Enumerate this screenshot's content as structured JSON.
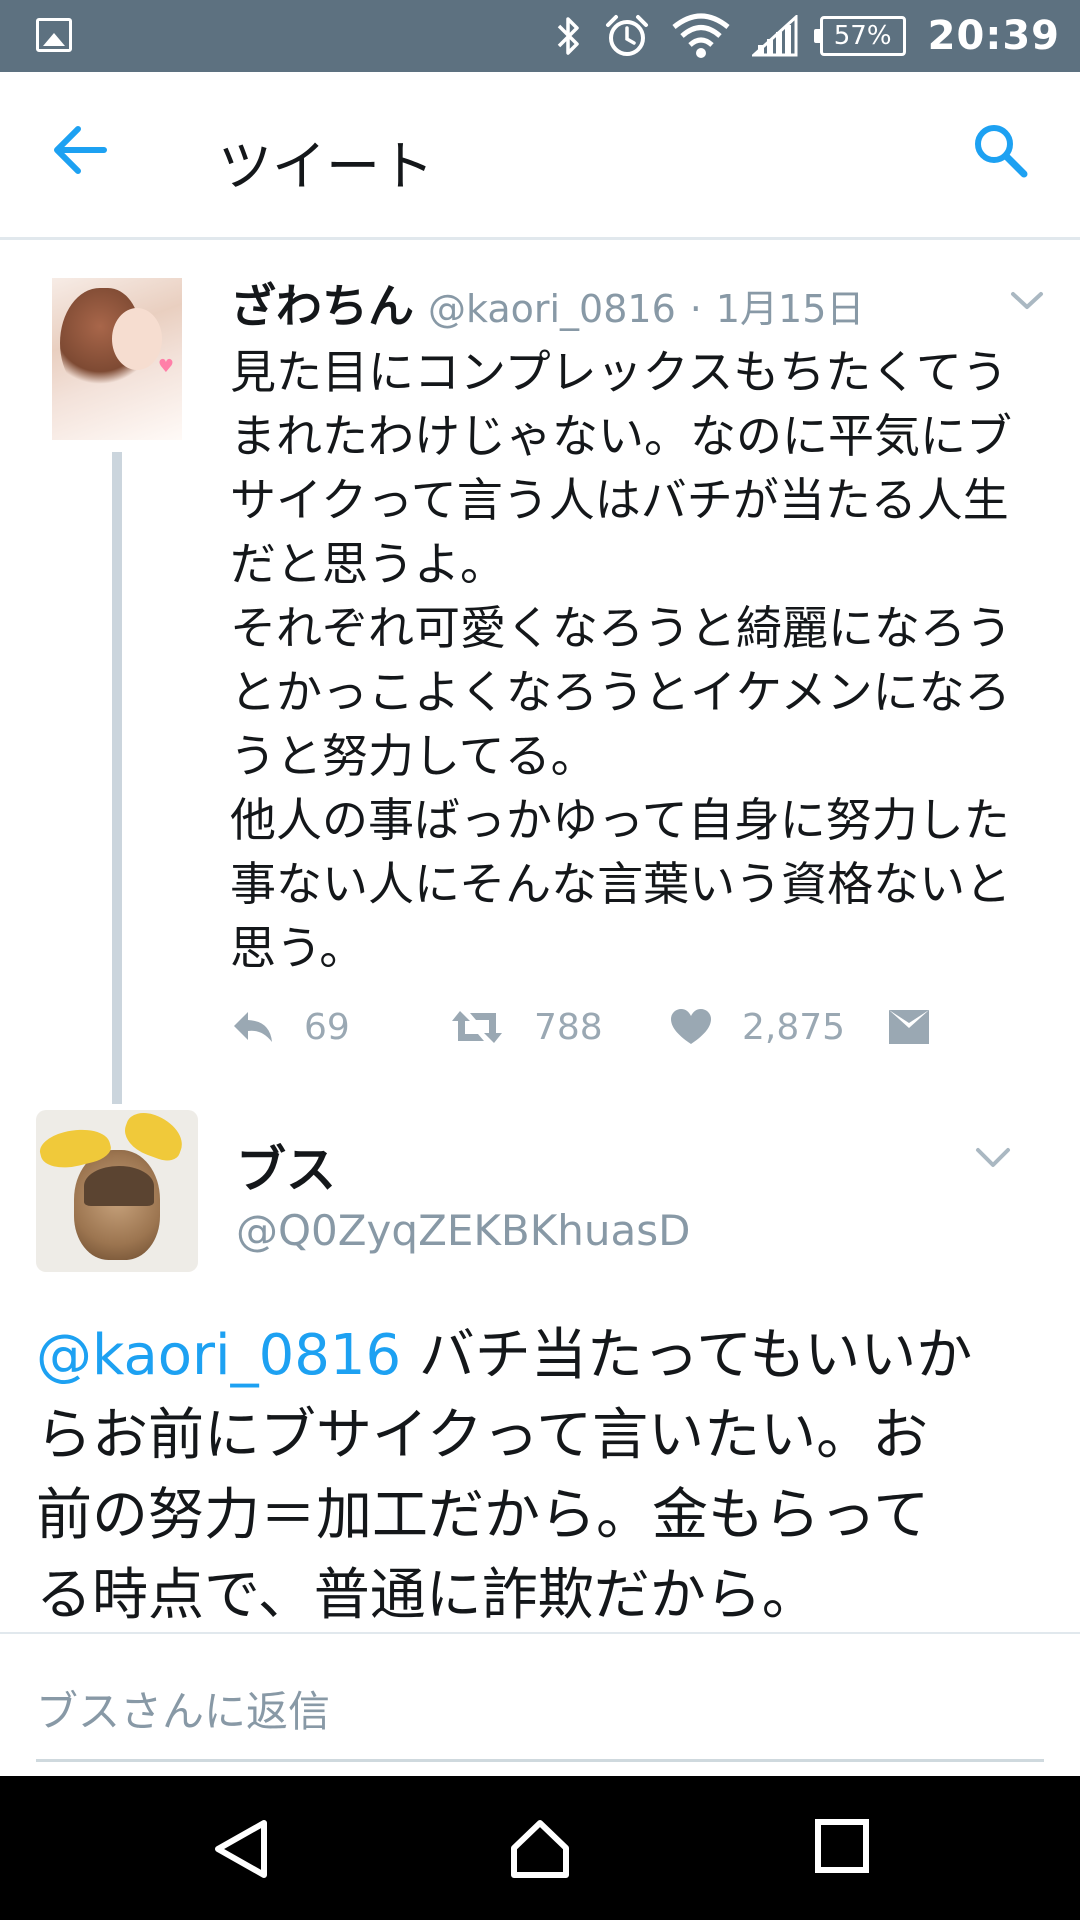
{
  "status_bar": {
    "battery_percent": "57%",
    "time": "20:39",
    "icons": [
      "gallery-icon",
      "bluetooth-icon",
      "alarm-icon",
      "wifi-icon",
      "signal-icon",
      "battery-icon"
    ]
  },
  "app_bar": {
    "title": "ツイート",
    "back_icon": "arrow-left-icon",
    "search_icon": "search-icon"
  },
  "tweet_1": {
    "display_name": "ざわちん",
    "handle": "@kaori_0816",
    "separator": "·",
    "date": "1月15日",
    "lines": [
      "見た目にコンプレックスもちたくてう",
      "まれたわけじゃない。なのに平気にブ",
      "サイクって言う人はバチが当たる人生",
      "だと思うよ。",
      "それぞれ可愛くなろうと綺麗になろう",
      "とかっこよくなろうとイケメンになろ",
      "うと努力してる。",
      "他人の事ばっかゆって自身に努力した",
      "事ない人にそんな言葉いう資格ないと",
      "思う。"
    ],
    "reply_count": "69",
    "retweet_count": "788",
    "like_count": "2,875",
    "colors": {
      "icon": "#9aa8b3",
      "thread_line": "#cbd5dd"
    }
  },
  "tweet_2": {
    "display_name": "ブス",
    "handle": "@Q0ZyqZEKBKhuasD",
    "mention": "@kaori_0816",
    "line_1_rest": " バチ当たってもいいか",
    "lines": [
      "らお前にブサイクって言いたい。お",
      "前の努力＝加工だから。金もらって",
      "る時点で、普通に詐欺だから。"
    ],
    "colors": {
      "mention": "#1da1f2"
    }
  },
  "reply": {
    "placeholder": "ブスさんに返信"
  },
  "nav_bar": {
    "buttons": [
      "back-triangle-icon",
      "home-icon",
      "recents-square-icon"
    ]
  }
}
